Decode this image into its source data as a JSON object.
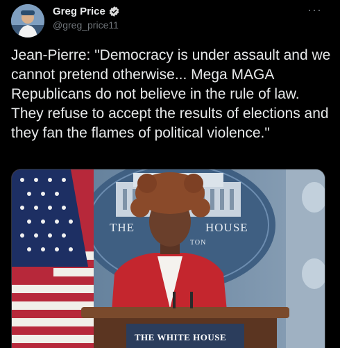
{
  "author": {
    "display_name": "Greg Price",
    "handle": "@greg_price11",
    "verified": true
  },
  "menu": {
    "more_glyph": "···"
  },
  "tweet": {
    "text": "Jean-Pierre: \"Democracy is under assault and we cannot pretend otherwise... Mega MAGA Republicans do not believe in the rule of law. They refuse to accept the results of elections and they fan the flames of political violence.\""
  },
  "media": {
    "backdrop_text_left": "THE",
    "backdrop_text_right": "HOUSE",
    "backdrop_text_bottom": "TON",
    "podium_text": "THE WHITE HOUSE"
  },
  "colors": {
    "background": "#000000",
    "text_primary": "#e7e9ea",
    "text_secondary": "#71767b",
    "verified_badge": "#d9d9d9",
    "backdrop_blue": "#3f5f82"
  }
}
